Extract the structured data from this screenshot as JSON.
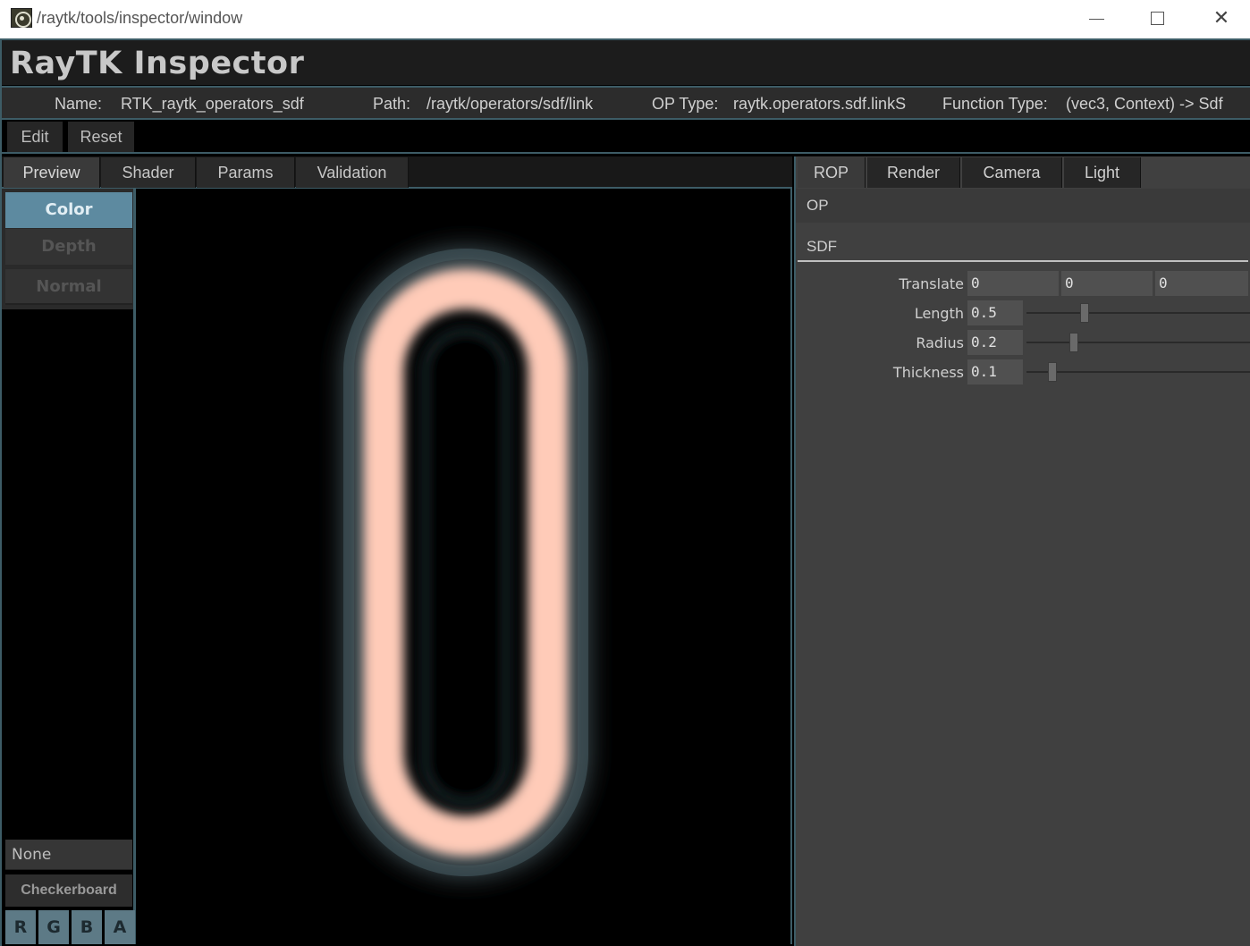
{
  "window": {
    "title": "/raytk/tools/inspector/window",
    "minimize": "—",
    "maximize": "☐",
    "close": "✕"
  },
  "header": {
    "title": "RayTK Inspector"
  },
  "info": {
    "name_label": "Name:",
    "name_value": "RTK_raytk_operators_sdf",
    "path_label": "Path:",
    "path_value": "/raytk/operators/sdf/link",
    "optype_label": "OP Type:",
    "optype_value": "raytk.operators.sdf.linkS",
    "functype_label": "Function Type:",
    "functype_value": "(vec3, Context) -> Sdf"
  },
  "editbar": {
    "edit": "Edit",
    "reset": "Reset"
  },
  "left_tabs": [
    "Preview",
    "Shader",
    "Params",
    "Validation"
  ],
  "preview_modes": {
    "color": "Color",
    "depth": "Depth",
    "normal": "Normal"
  },
  "background": {
    "value": "None",
    "checkerboard": "Checkerboard"
  },
  "channels": [
    "R",
    "G",
    "B",
    "A"
  ],
  "right_tabs": [
    "ROP",
    "Render",
    "Camera",
    "Light"
  ],
  "rop": {
    "op_label": "OP",
    "sdf_label": "SDF",
    "params": {
      "translate": {
        "label": "Translate",
        "values": [
          "0",
          "0",
          "0"
        ]
      },
      "length": {
        "label": "Length",
        "value": "0.5",
        "slider": 0.5
      },
      "radius": {
        "label": "Radius",
        "value": "0.2",
        "slider": 0.2
      },
      "thickness": {
        "label": "Thickness",
        "value": "0.1",
        "slider": 0.1
      }
    }
  },
  "colors": {
    "accent": "#3d5c66",
    "active_mode": "#5d8aa0",
    "shape": "#ffcbb8"
  }
}
